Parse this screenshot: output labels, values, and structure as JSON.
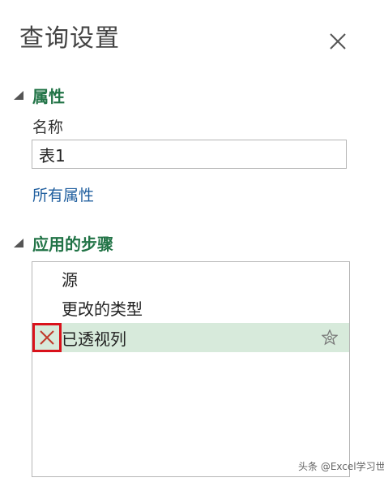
{
  "pane": {
    "title": "查询设置",
    "close_icon": "close-icon"
  },
  "properties": {
    "heading": "属性",
    "name_label": "名称",
    "name_value": "表1",
    "all_properties_link": "所有属性"
  },
  "applied_steps": {
    "heading": "应用的步骤",
    "steps": [
      {
        "label": "源",
        "selected": false
      },
      {
        "label": "更改的类型",
        "selected": false
      },
      {
        "label": "已透视列",
        "selected": true,
        "has_delete_icon": true,
        "has_settings_icon": true
      }
    ]
  },
  "watermark": "头条 @Excel学习世界",
  "colors": {
    "section_heading": "#217346",
    "link": "#1f5e9e",
    "selected_row": "#d7eadb",
    "delete_highlight": "#d9121b"
  }
}
